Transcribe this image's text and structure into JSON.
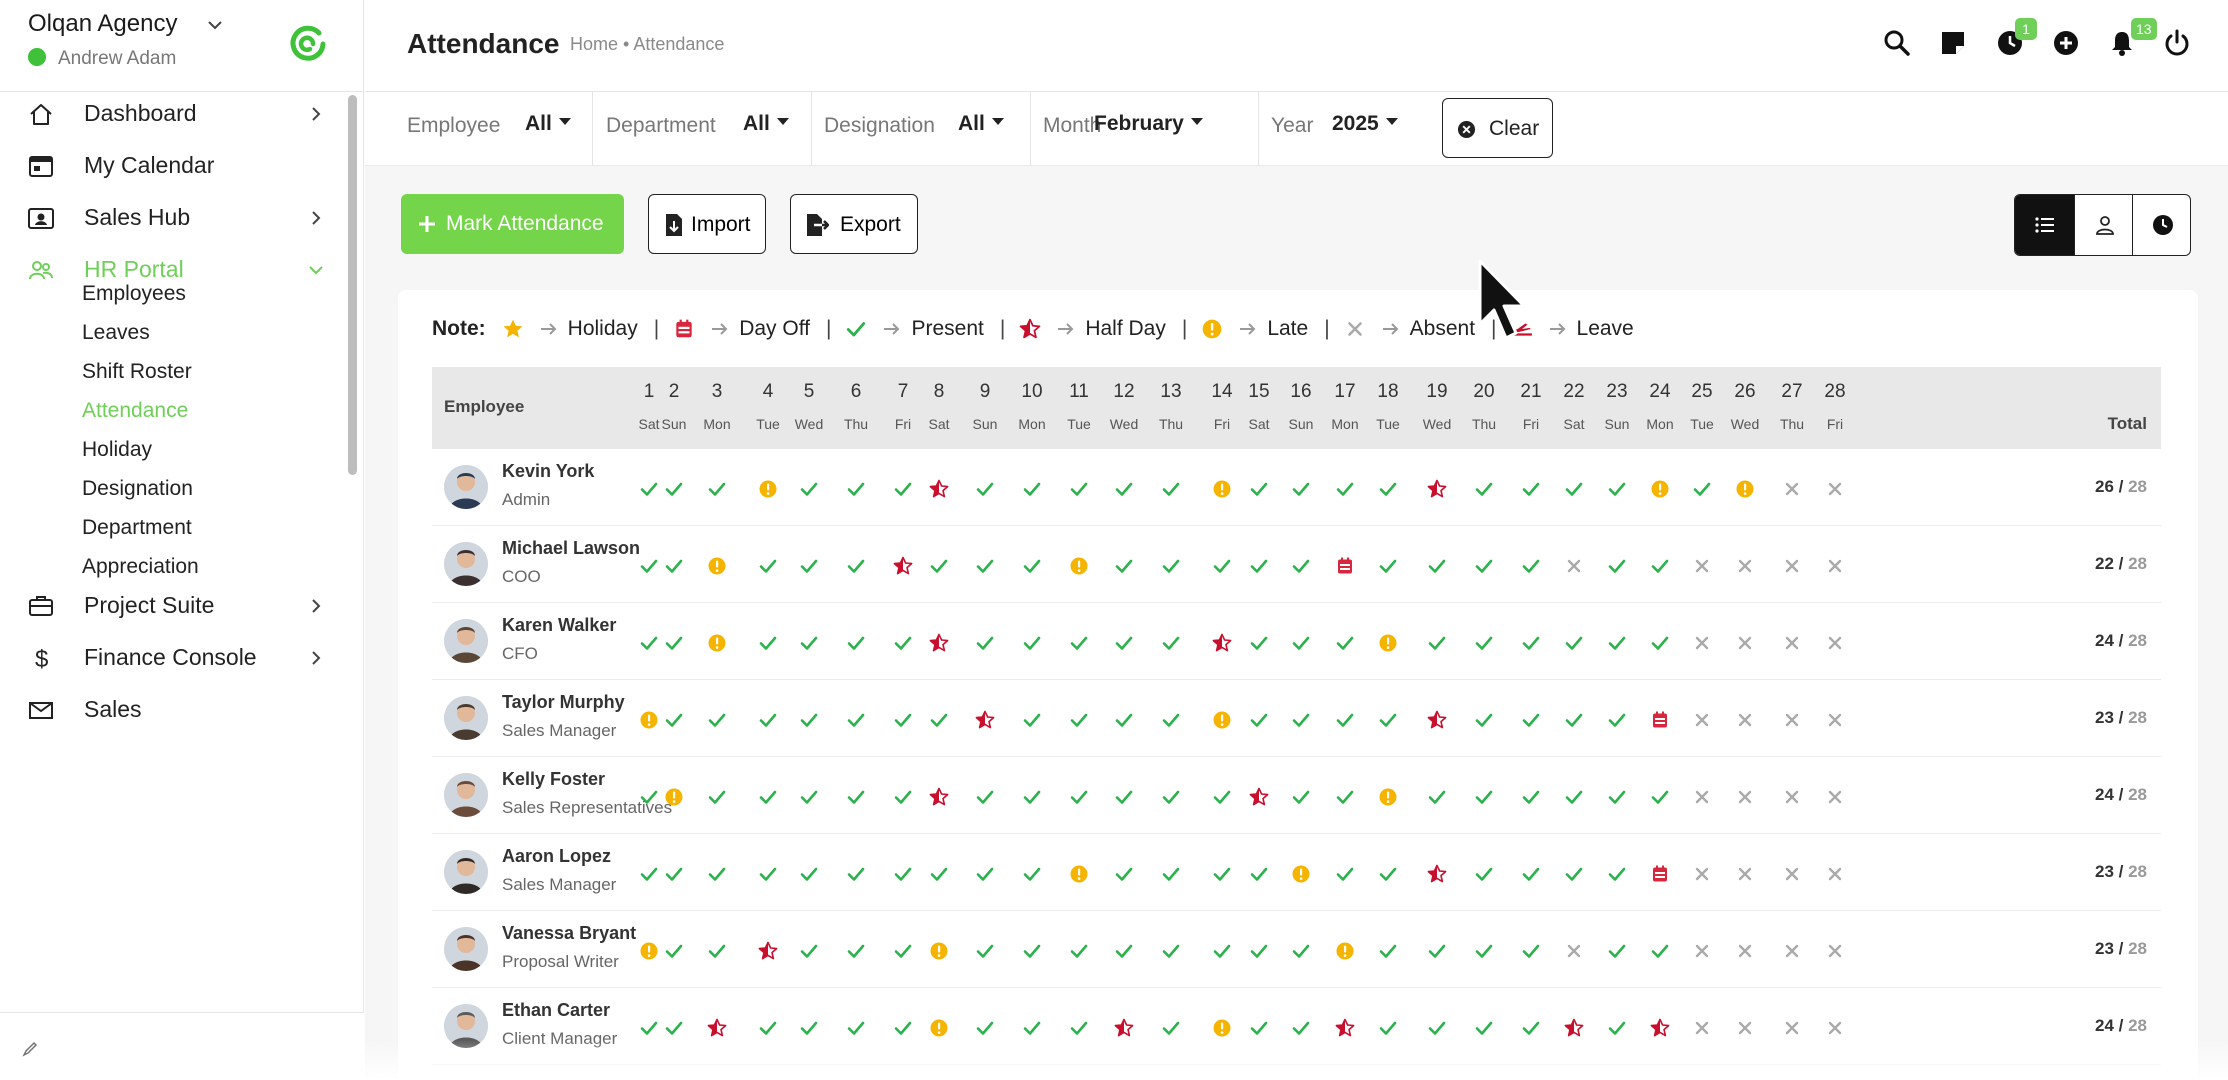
{
  "brand": {
    "name": "Olqan Agency",
    "user": "Andrew Adam",
    "status_color": "#3fc23a"
  },
  "nav": [
    {
      "label": "Dashboard",
      "icon": "home-icon",
      "chevron": "right"
    },
    {
      "label": "My Calendar",
      "icon": "calendar-icon",
      "chevron": ""
    },
    {
      "label": "Sales Hub",
      "icon": "contact-card-icon",
      "chevron": "right"
    },
    {
      "label": "HR Portal",
      "icon": "users-icon",
      "chevron": "down",
      "active": true
    },
    {
      "label": "Project Suite",
      "icon": "briefcase-icon",
      "chevron": "right"
    },
    {
      "label": "Finance Console",
      "icon": "dollar-icon",
      "chevron": "right"
    },
    {
      "label": "Sales",
      "icon": "mail-icon",
      "chevron": ""
    }
  ],
  "hr_sub": [
    "Employees",
    "Leaves",
    "Shift Roster",
    "Attendance",
    "Holiday",
    "Designation",
    "Department",
    "Appreciation"
  ],
  "hr_active": "Attendance",
  "header": {
    "title": "Attendance",
    "breadcrumb": "Home • Attendance",
    "badge_clock": "1",
    "badge_bell": "13",
    "accent": "#6fcf58"
  },
  "filters": {
    "employee": {
      "label": "Employee",
      "value": "All"
    },
    "department": {
      "label": "Department",
      "value": "All"
    },
    "designation": {
      "label": "Designation",
      "value": "All"
    },
    "month": {
      "label": "Month",
      "value": "February"
    },
    "year": {
      "label": "Year",
      "value": "2025"
    },
    "clear": "Clear"
  },
  "actions": {
    "mark": "Mark Attendance",
    "import": "Import",
    "export": "Export"
  },
  "view_toggle": [
    "list-view-icon",
    "user-view-icon",
    "clock-view-icon"
  ],
  "legend": {
    "title": "Note:",
    "items": [
      {
        "icon": "star-icon",
        "label": "Holiday"
      },
      {
        "icon": "calendar-dayoff-icon",
        "label": "Day Off"
      },
      {
        "icon": "check-icon",
        "label": "Present"
      },
      {
        "icon": "half-star-icon",
        "label": "Half Day"
      },
      {
        "icon": "late-icon",
        "label": "Late"
      },
      {
        "icon": "cross-icon",
        "label": "Absent"
      },
      {
        "icon": "plane-icon",
        "label": "Leave"
      }
    ]
  },
  "table": {
    "employee_header": "Employee",
    "total_header": "Total",
    "days": [
      {
        "d": "1",
        "w": "Sat"
      },
      {
        "d": "2",
        "w": "Sun"
      },
      {
        "d": "3",
        "w": "Mon"
      },
      {
        "d": "4",
        "w": "Tue"
      },
      {
        "d": "5",
        "w": "Wed"
      },
      {
        "d": "6",
        "w": "Thu"
      },
      {
        "d": "7",
        "w": "Fri"
      },
      {
        "d": "8",
        "w": "Sat"
      },
      {
        "d": "9",
        "w": "Sun"
      },
      {
        "d": "10",
        "w": "Mon"
      },
      {
        "d": "11",
        "w": "Tue"
      },
      {
        "d": "12",
        "w": "Wed"
      },
      {
        "d": "13",
        "w": "Thu"
      },
      {
        "d": "14",
        "w": "Fri"
      },
      {
        "d": "15",
        "w": "Sat"
      },
      {
        "d": "16",
        "w": "Sun"
      },
      {
        "d": "17",
        "w": "Mon"
      },
      {
        "d": "18",
        "w": "Tue"
      },
      {
        "d": "19",
        "w": "Wed"
      },
      {
        "d": "20",
        "w": "Thu"
      },
      {
        "d": "21",
        "w": "Fri"
      },
      {
        "d": "22",
        "w": "Sat"
      },
      {
        "d": "23",
        "w": "Sun"
      },
      {
        "d": "24",
        "w": "Mon"
      },
      {
        "d": "25",
        "w": "Tue"
      },
      {
        "d": "26",
        "w": "Wed"
      },
      {
        "d": "27",
        "w": "Thu"
      },
      {
        "d": "28",
        "w": "Fri"
      }
    ],
    "codes": {
      "P": "present",
      "L": "late",
      "H": "half-day",
      "D": "day-off",
      "A": "absent"
    },
    "rows": [
      {
        "name": "Kevin York",
        "role": "Admin",
        "status": "PPPLPPPHPPPPPLPPPPHPPPPLPLAA",
        "present": "26",
        "total": "28"
      },
      {
        "name": "Michael Lawson",
        "role": "COO",
        "status": "PPLPPPHPPPLPPPPPDPPPPAPPAAAA",
        "present": "22",
        "total": "28"
      },
      {
        "name": "Karen Walker",
        "role": "CFO",
        "status": "PPLPPPPHPPPPPHPPPLPPPPPPAAAA",
        "present": "24",
        "total": "28"
      },
      {
        "name": "Taylor Murphy",
        "role": "Sales Manager",
        "status": "LPPPPPPPHPPPPLPPPPHPPPPDAAAA",
        "present": "23",
        "total": "28"
      },
      {
        "name": "Kelly Foster",
        "role": "Sales Representatives",
        "status": "PLPPPPPHPPPPPPHPPLPPPPPPAAAA",
        "present": "24",
        "total": "28"
      },
      {
        "name": "Aaron Lopez",
        "role": "Sales Manager",
        "status": "PPPPPPPPPPLPPPPLPPHPPPPDAAAA",
        "present": "23",
        "total": "28"
      },
      {
        "name": "Vanessa Bryant",
        "role": "Proposal Writer",
        "status": "LPPHPPPLPPPPPPPPLPPPPAPPAAAA",
        "present": "23",
        "total": "28"
      },
      {
        "name": "Ethan Carter",
        "role": "Client Manager",
        "status": "PPHPPPPLPPPHPLPPHPPPPHPHAAAA",
        "present": "24",
        "total": "28"
      }
    ]
  }
}
